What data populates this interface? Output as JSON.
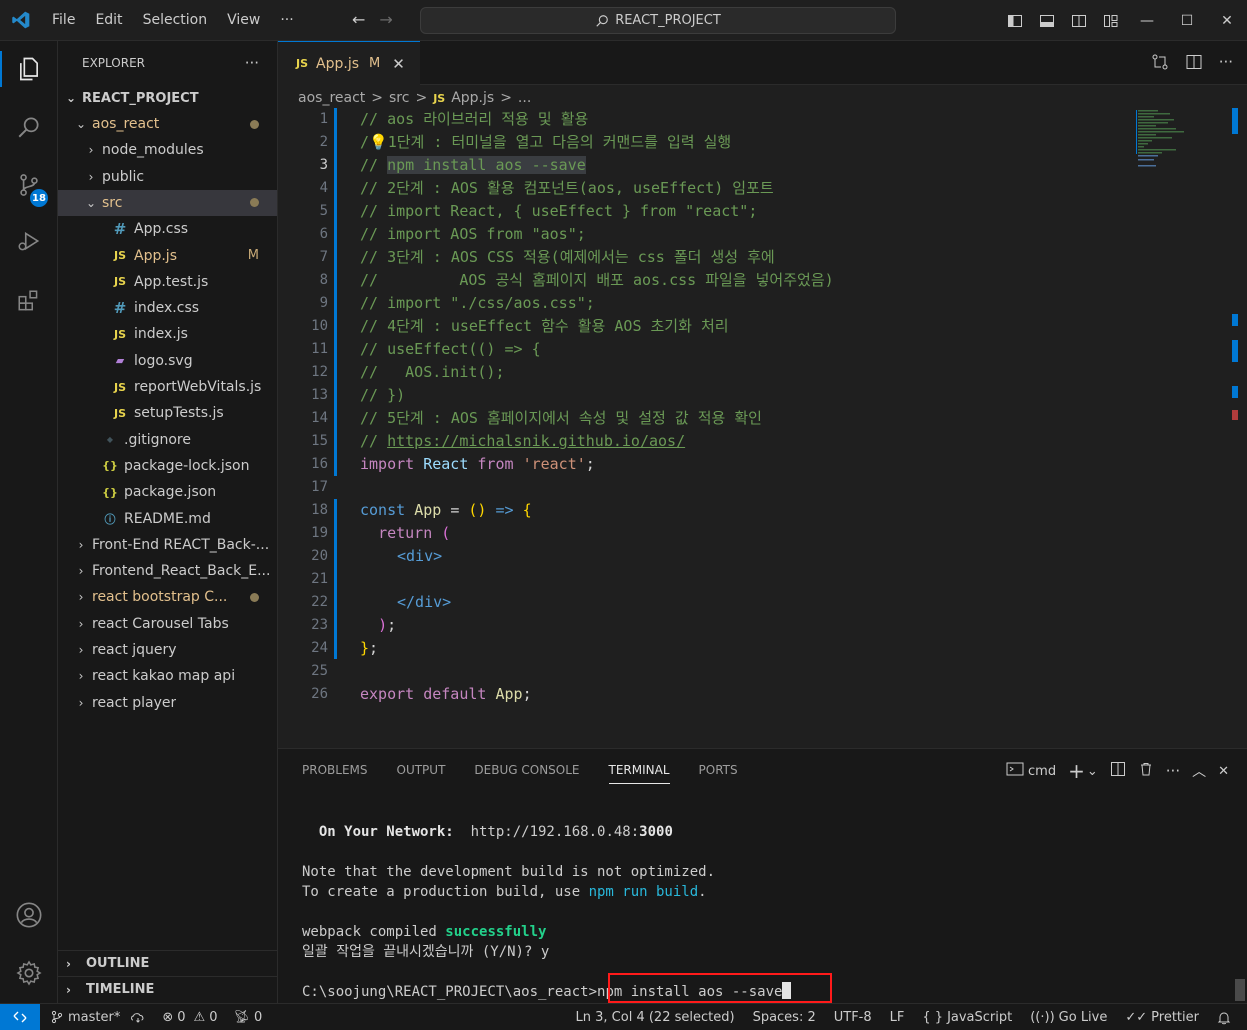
{
  "menu": [
    "File",
    "Edit",
    "Selection",
    "View",
    "···"
  ],
  "search": {
    "text": "REACT_PROJECT"
  },
  "explorer": {
    "title": "EXPLORER",
    "more": "···",
    "root": "REACT_PROJECT",
    "items": [
      {
        "name": "aos_react",
        "type": "folder-open",
        "level": 1,
        "status": "dot",
        "color": "#e2c08d"
      },
      {
        "name": "node_modules",
        "type": "folder",
        "level": 2
      },
      {
        "name": "public",
        "type": "folder",
        "level": 2
      },
      {
        "name": "src",
        "type": "folder-open",
        "level": 2,
        "status": "dot",
        "color": "#e2c08d"
      },
      {
        "name": "App.css",
        "type": "css",
        "level": 3
      },
      {
        "name": "App.js",
        "type": "js",
        "level": 3,
        "status": "M",
        "color": "#e2c08d"
      },
      {
        "name": "App.test.js",
        "type": "js",
        "level": 3
      },
      {
        "name": "index.css",
        "type": "css",
        "level": 3
      },
      {
        "name": "index.js",
        "type": "js",
        "level": 3
      },
      {
        "name": "logo.svg",
        "type": "svg",
        "level": 3
      },
      {
        "name": "reportWebVitals.js",
        "type": "js",
        "level": 3
      },
      {
        "name": "setupTests.js",
        "type": "js",
        "level": 3
      },
      {
        "name": ".gitignore",
        "type": "git",
        "level": 2
      },
      {
        "name": "package-lock.json",
        "type": "json",
        "level": 2
      },
      {
        "name": "package.json",
        "type": "json",
        "level": 2
      },
      {
        "name": "README.md",
        "type": "info",
        "level": 2
      },
      {
        "name": "Front-End REACT_Back-...",
        "type": "folder",
        "level": 1
      },
      {
        "name": "Frontend_React_Back_E...",
        "type": "folder",
        "level": 1
      },
      {
        "name": "react bootstrap C...",
        "type": "folder",
        "level": 1,
        "status": "dot",
        "color": "#e2c08d"
      },
      {
        "name": "react Carousel Tabs",
        "type": "folder",
        "level": 1
      },
      {
        "name": "react jquery",
        "type": "folder",
        "level": 1
      },
      {
        "name": "react kakao map api",
        "type": "folder",
        "level": 1
      },
      {
        "name": "react player",
        "type": "folder",
        "level": 1
      }
    ],
    "outline": "OUTLINE",
    "timeline": "TIMELINE"
  },
  "activity_badge": "18",
  "tab": {
    "badge": "JS",
    "name": "App.js",
    "modified": "M",
    "close": "✕"
  },
  "breadcrumb": [
    "aos_react",
    "src",
    "App.js",
    "..."
  ],
  "breadcrumb_sep": ">",
  "breadcrumb_badge": "JS",
  "lines": [
    "1",
    "2",
    "3",
    "4",
    "5",
    "6",
    "7",
    "8",
    "9",
    "10",
    "11",
    "12",
    "13",
    "14",
    "15",
    "16",
    "17",
    "18",
    "19",
    "20",
    "21",
    "22",
    "23",
    "24",
    "25",
    "26"
  ],
  "code": {
    "l1": "// aos 라이브러리 적용 및 활용",
    "l2": "1단계 : 터미널을 열고 다음의 커맨드를 입력 실행",
    "l3": "npm install aos --save",
    "l4": "// 2단계 : AOS 활용 컴포넌트(aos, useEffect) 임포트",
    "l5": "// import React, { useEffect } from \"react\";",
    "l6": "// import AOS from \"aos\";",
    "l7": "// 3단계 : AOS CSS 적용(예제에서는 css 폴더 생성 후에",
    "l8": "//         AOS 공식 홈페이지 배포 aos.css 파일을 넣어주었음)",
    "l9": "// import \"./css/aos.css\";",
    "l10": "// 4단계 : useEffect 함수 활용 AOS 초기화 처리",
    "l11": "// useEffect(() => {",
    "l12": "//   AOS.init();",
    "l13": "// })",
    "l14": "// 5단계 : AOS 홈페이지에서 속성 및 설정 값 적용 확인",
    "l15_prefix": "// ",
    "l15_link": "https://michalsnik.github.io/aos/",
    "l16_import": "import",
    "l16_react": "React",
    "l16_from": "from",
    "l16_str": "'react'",
    "l18_const": "const",
    "l18_app": "App",
    "l19_return": "return",
    "l20": "<div>",
    "l22": "</div>",
    "l26_export": "export",
    "l26_default": "default",
    "l26_app": "App"
  },
  "panel": {
    "tabs": [
      "PROBLEMS",
      "OUTPUT",
      "DEBUG CONSOLE",
      "TERMINAL",
      "PORTS"
    ],
    "shell": "cmd",
    "terminal": {
      "network_label": "  On Your Network:",
      "network_url": "http://192.168.0.48:",
      "network_port": "3000",
      "note1": "Note that the development build is not optimized.",
      "note2_prefix": "To create a production build, use ",
      "note2_cmd": "npm run build",
      "note2_suffix": ".",
      "compiled_prefix": "webpack compiled ",
      "compiled_status": "successfully",
      "batch": "일괄 작업을 끝내시겠습니까 (Y/N)? y",
      "prompt": "C:\\soojung\\REACT_PROJECT\\aos_react>",
      "command": "npm install aos --save"
    }
  },
  "status": {
    "branch": "master*",
    "errors": "0",
    "warnings": "0",
    "ports": "0",
    "cursor": "Ln 3, Col 4 (22 selected)",
    "spaces": "Spaces: 2",
    "encoding": "UTF-8",
    "eol": "LF",
    "language": "JavaScript",
    "golive": "Go Live",
    "prettier": "Prettier"
  },
  "colors": {
    "accent": "#0078d4",
    "highlight_box": "#ff1a1a"
  }
}
